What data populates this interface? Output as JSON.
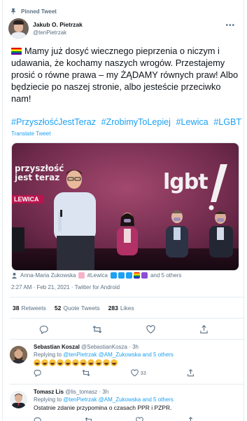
{
  "tweet": {
    "pinned_label": "Pinned Tweet",
    "author_name": "Jakub O. Pietrzak",
    "author_handle": "@tenPietrzak",
    "text": "Mamy już dosyć wiecznego pieprzenia o niczym i udawania, że kochamy naszych wrogów. Przestajemy prosić o równe prawa – my ŻĄDAMY równych praw! Albo będziecie po naszej stronie, albo jesteście przeciwko nam!",
    "hashtags": [
      "#PrzyszłośćJestTeraz",
      "#ZrobimyToLepiej",
      "#Lewica",
      "#LGBT"
    ],
    "translate_label": "Translate Tweet",
    "image_text": {
      "line1": "przyszłość",
      "line2": "jest teraz",
      "banner": "LEWICA",
      "big": "lgbt"
    },
    "tagged": {
      "person": "Anna-Maria Zukowska",
      "tag": "#Lewica",
      "others": "and 5 others"
    },
    "timestamp": "2:27 AM · Feb 21, 2021 · Twitter for Android",
    "stats": {
      "retweets_count": "38",
      "retweets_label": "Retweets",
      "quotes_count": "52",
      "quotes_label": "Quote Tweets",
      "likes_count": "283",
      "likes_label": "Likes"
    }
  },
  "replies": [
    {
      "name": "Sebastian Koszal",
      "handle": "@SebastianKosza",
      "time": "· 3h",
      "replying_prefix": "Replying to",
      "replying_links": "@tenPietrzak @AM_Zukowska",
      "replying_suffix": "and 5 others",
      "laugh_count": 11,
      "like_count": "33"
    },
    {
      "name": "Tomasz Lis",
      "handle": "@lis_tomasz",
      "time": "· 3h",
      "replying_prefix": "Replying to",
      "replying_links": "@tenPietrzak @AM_Zukowska",
      "replying_suffix": "and 5 others",
      "body": "Ostatnie zdanie przypomina o czasach PPR i PZPR."
    }
  ],
  "colors": {
    "accent": "#1da1f2",
    "muted": "#5b7083",
    "media_bg": "#6e2a4b"
  },
  "icons": [
    "pin-icon",
    "more-icon",
    "reply-icon",
    "retweet-icon",
    "like-icon",
    "share-icon",
    "person-icon"
  ]
}
